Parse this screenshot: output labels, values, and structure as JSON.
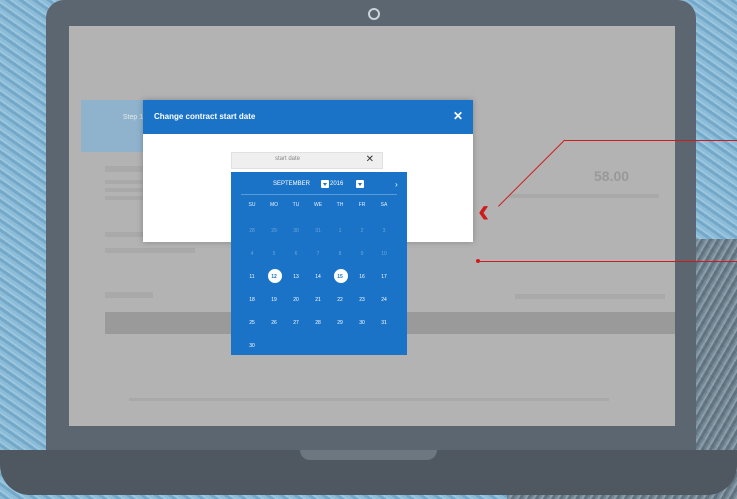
{
  "modal": {
    "title": "Change contract start date",
    "close_glyph": "✕",
    "date_input": {
      "placeholder": "start date",
      "clear_glyph": "✕"
    }
  },
  "calendar": {
    "month": "SEPTEMBER",
    "year": "2016",
    "next_glyph": "›",
    "weekdays": [
      "SU",
      "MO",
      "TU",
      "WE",
      "TH",
      "FR",
      "SA"
    ],
    "days": [
      {
        "label": "28",
        "muted": true
      },
      {
        "label": "29",
        "muted": true
      },
      {
        "label": "30",
        "muted": true
      },
      {
        "label": "31",
        "muted": true
      },
      {
        "label": "1",
        "muted": true
      },
      {
        "label": "2",
        "muted": true
      },
      {
        "label": "3",
        "muted": true
      },
      {
        "label": "4",
        "muted": true
      },
      {
        "label": "5",
        "muted": true
      },
      {
        "label": "6",
        "muted": true
      },
      {
        "label": "7",
        "muted": true
      },
      {
        "label": "8",
        "muted": true
      },
      {
        "label": "9",
        "muted": true
      },
      {
        "label": "10",
        "muted": true
      },
      {
        "label": "11",
        "muted": false
      },
      {
        "label": "12",
        "muted": false,
        "circled": true
      },
      {
        "label": "13",
        "muted": false
      },
      {
        "label": "14",
        "muted": false
      },
      {
        "label": "15",
        "muted": false,
        "circled": true
      },
      {
        "label": "16",
        "muted": false
      },
      {
        "label": "17",
        "muted": false
      },
      {
        "label": "18",
        "muted": false
      },
      {
        "label": "19",
        "muted": false
      },
      {
        "label": "20",
        "muted": false
      },
      {
        "label": "21",
        "muted": false
      },
      {
        "label": "22",
        "muted": false
      },
      {
        "label": "23",
        "muted": false
      },
      {
        "label": "24",
        "muted": false
      },
      {
        "label": "25",
        "muted": false
      },
      {
        "label": "26",
        "muted": false
      },
      {
        "label": "27",
        "muted": false
      },
      {
        "label": "28",
        "muted": false
      },
      {
        "label": "29",
        "muted": false
      },
      {
        "label": "30",
        "muted": false
      },
      {
        "label": "31",
        "muted": false
      },
      {
        "label": "30",
        "muted": false
      }
    ]
  },
  "background_page": {
    "price": "58.00",
    "step_active_label": "Step 1"
  },
  "colors": {
    "accent": "#1a73c7",
    "annotation": "#d01b1b"
  }
}
